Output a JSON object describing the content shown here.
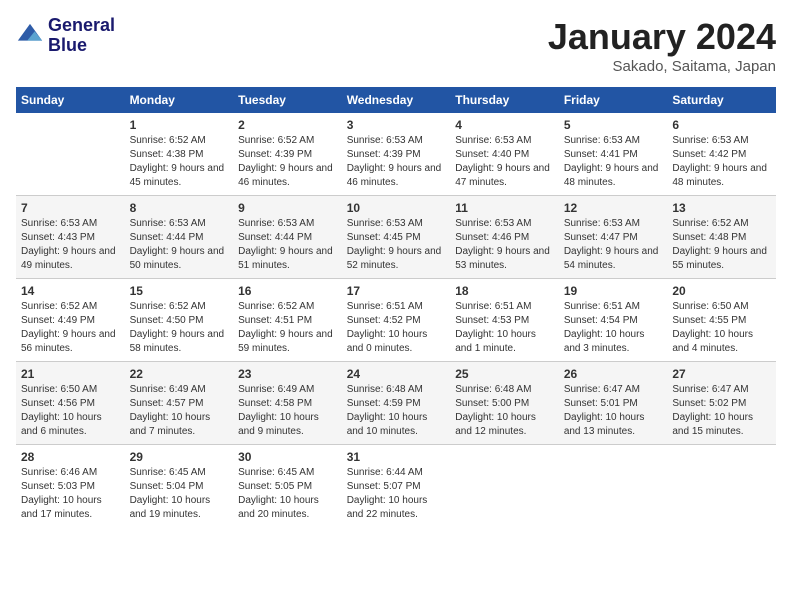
{
  "logo": {
    "text1": "General",
    "text2": "Blue"
  },
  "header": {
    "title": "January 2024",
    "subtitle": "Sakado, Saitama, Japan"
  },
  "columns": [
    "Sunday",
    "Monday",
    "Tuesday",
    "Wednesday",
    "Thursday",
    "Friday",
    "Saturday"
  ],
  "weeks": [
    [
      {
        "day": "",
        "sunrise": "",
        "sunset": "",
        "daylight": ""
      },
      {
        "day": "1",
        "sunrise": "Sunrise: 6:52 AM",
        "sunset": "Sunset: 4:38 PM",
        "daylight": "Daylight: 9 hours and 45 minutes."
      },
      {
        "day": "2",
        "sunrise": "Sunrise: 6:52 AM",
        "sunset": "Sunset: 4:39 PM",
        "daylight": "Daylight: 9 hours and 46 minutes."
      },
      {
        "day": "3",
        "sunrise": "Sunrise: 6:53 AM",
        "sunset": "Sunset: 4:39 PM",
        "daylight": "Daylight: 9 hours and 46 minutes."
      },
      {
        "day": "4",
        "sunrise": "Sunrise: 6:53 AM",
        "sunset": "Sunset: 4:40 PM",
        "daylight": "Daylight: 9 hours and 47 minutes."
      },
      {
        "day": "5",
        "sunrise": "Sunrise: 6:53 AM",
        "sunset": "Sunset: 4:41 PM",
        "daylight": "Daylight: 9 hours and 48 minutes."
      },
      {
        "day": "6",
        "sunrise": "Sunrise: 6:53 AM",
        "sunset": "Sunset: 4:42 PM",
        "daylight": "Daylight: 9 hours and 48 minutes."
      }
    ],
    [
      {
        "day": "7",
        "sunrise": "Sunrise: 6:53 AM",
        "sunset": "Sunset: 4:43 PM",
        "daylight": "Daylight: 9 hours and 49 minutes."
      },
      {
        "day": "8",
        "sunrise": "Sunrise: 6:53 AM",
        "sunset": "Sunset: 4:44 PM",
        "daylight": "Daylight: 9 hours and 50 minutes."
      },
      {
        "day": "9",
        "sunrise": "Sunrise: 6:53 AM",
        "sunset": "Sunset: 4:44 PM",
        "daylight": "Daylight: 9 hours and 51 minutes."
      },
      {
        "day": "10",
        "sunrise": "Sunrise: 6:53 AM",
        "sunset": "Sunset: 4:45 PM",
        "daylight": "Daylight: 9 hours and 52 minutes."
      },
      {
        "day": "11",
        "sunrise": "Sunrise: 6:53 AM",
        "sunset": "Sunset: 4:46 PM",
        "daylight": "Daylight: 9 hours and 53 minutes."
      },
      {
        "day": "12",
        "sunrise": "Sunrise: 6:53 AM",
        "sunset": "Sunset: 4:47 PM",
        "daylight": "Daylight: 9 hours and 54 minutes."
      },
      {
        "day": "13",
        "sunrise": "Sunrise: 6:52 AM",
        "sunset": "Sunset: 4:48 PM",
        "daylight": "Daylight: 9 hours and 55 minutes."
      }
    ],
    [
      {
        "day": "14",
        "sunrise": "Sunrise: 6:52 AM",
        "sunset": "Sunset: 4:49 PM",
        "daylight": "Daylight: 9 hours and 56 minutes."
      },
      {
        "day": "15",
        "sunrise": "Sunrise: 6:52 AM",
        "sunset": "Sunset: 4:50 PM",
        "daylight": "Daylight: 9 hours and 58 minutes."
      },
      {
        "day": "16",
        "sunrise": "Sunrise: 6:52 AM",
        "sunset": "Sunset: 4:51 PM",
        "daylight": "Daylight: 9 hours and 59 minutes."
      },
      {
        "day": "17",
        "sunrise": "Sunrise: 6:51 AM",
        "sunset": "Sunset: 4:52 PM",
        "daylight": "Daylight: 10 hours and 0 minutes."
      },
      {
        "day": "18",
        "sunrise": "Sunrise: 6:51 AM",
        "sunset": "Sunset: 4:53 PM",
        "daylight": "Daylight: 10 hours and 1 minute."
      },
      {
        "day": "19",
        "sunrise": "Sunrise: 6:51 AM",
        "sunset": "Sunset: 4:54 PM",
        "daylight": "Daylight: 10 hours and 3 minutes."
      },
      {
        "day": "20",
        "sunrise": "Sunrise: 6:50 AM",
        "sunset": "Sunset: 4:55 PM",
        "daylight": "Daylight: 10 hours and 4 minutes."
      }
    ],
    [
      {
        "day": "21",
        "sunrise": "Sunrise: 6:50 AM",
        "sunset": "Sunset: 4:56 PM",
        "daylight": "Daylight: 10 hours and 6 minutes."
      },
      {
        "day": "22",
        "sunrise": "Sunrise: 6:49 AM",
        "sunset": "Sunset: 4:57 PM",
        "daylight": "Daylight: 10 hours and 7 minutes."
      },
      {
        "day": "23",
        "sunrise": "Sunrise: 6:49 AM",
        "sunset": "Sunset: 4:58 PM",
        "daylight": "Daylight: 10 hours and 9 minutes."
      },
      {
        "day": "24",
        "sunrise": "Sunrise: 6:48 AM",
        "sunset": "Sunset: 4:59 PM",
        "daylight": "Daylight: 10 hours and 10 minutes."
      },
      {
        "day": "25",
        "sunrise": "Sunrise: 6:48 AM",
        "sunset": "Sunset: 5:00 PM",
        "daylight": "Daylight: 10 hours and 12 minutes."
      },
      {
        "day": "26",
        "sunrise": "Sunrise: 6:47 AM",
        "sunset": "Sunset: 5:01 PM",
        "daylight": "Daylight: 10 hours and 13 minutes."
      },
      {
        "day": "27",
        "sunrise": "Sunrise: 6:47 AM",
        "sunset": "Sunset: 5:02 PM",
        "daylight": "Daylight: 10 hours and 15 minutes."
      }
    ],
    [
      {
        "day": "28",
        "sunrise": "Sunrise: 6:46 AM",
        "sunset": "Sunset: 5:03 PM",
        "daylight": "Daylight: 10 hours and 17 minutes."
      },
      {
        "day": "29",
        "sunrise": "Sunrise: 6:45 AM",
        "sunset": "Sunset: 5:04 PM",
        "daylight": "Daylight: 10 hours and 19 minutes."
      },
      {
        "day": "30",
        "sunrise": "Sunrise: 6:45 AM",
        "sunset": "Sunset: 5:05 PM",
        "daylight": "Daylight: 10 hours and 20 minutes."
      },
      {
        "day": "31",
        "sunrise": "Sunrise: 6:44 AM",
        "sunset": "Sunset: 5:07 PM",
        "daylight": "Daylight: 10 hours and 22 minutes."
      },
      {
        "day": "",
        "sunrise": "",
        "sunset": "",
        "daylight": ""
      },
      {
        "day": "",
        "sunrise": "",
        "sunset": "",
        "daylight": ""
      },
      {
        "day": "",
        "sunrise": "",
        "sunset": "",
        "daylight": ""
      }
    ]
  ]
}
